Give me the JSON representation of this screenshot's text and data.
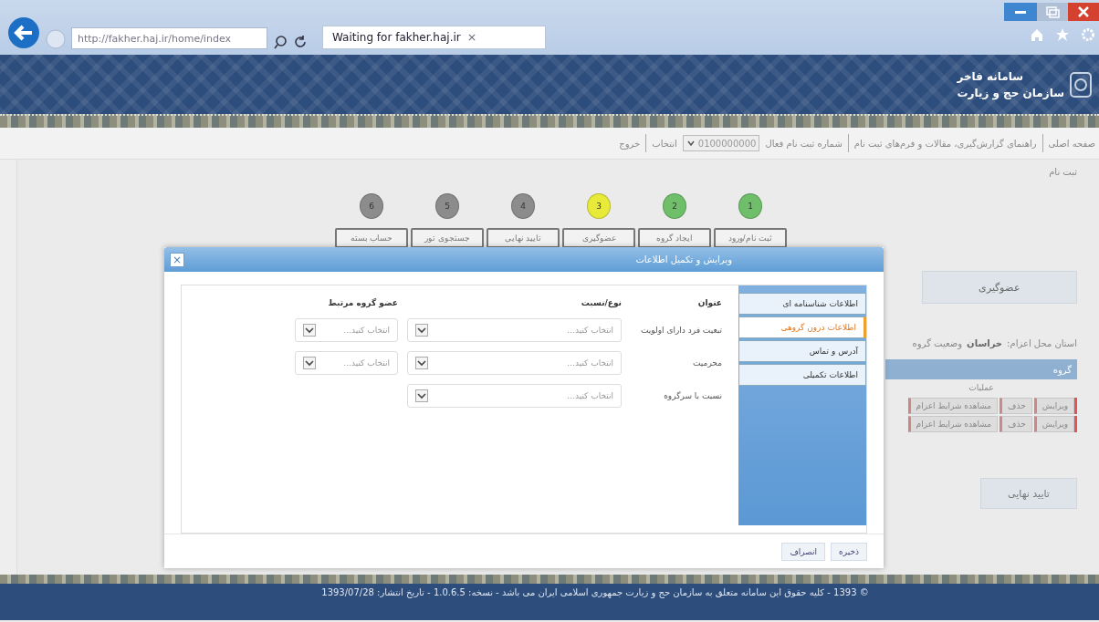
{
  "browser": {
    "url": "http://fakher.haj.ir/home/index",
    "tab_title": "Waiting for fakher.haj.ir"
  },
  "header": {
    "title": "سامانه فاخر",
    "subtitle": "سازمان حج و زیارت"
  },
  "nav": {
    "items": [
      "صفحه اصلی",
      "راهنمای گزارش‌گیری، مقالات و فرم‌های ثبت نام"
    ],
    "registration_label": "شماره ثبت نام فعال",
    "registration_value": "0100000000",
    "choose": "انتخاب",
    "logout": "خروج"
  },
  "page_title": "ثبت نام",
  "steps": [
    {
      "number": "1",
      "label": "ثبت نام/ورود",
      "color": "#6fbf6a"
    },
    {
      "number": "2",
      "label": "ایجاد گروه",
      "color": "#6fbf6a"
    },
    {
      "number": "3",
      "label": "عضوگیری",
      "color": "#e8ea3a"
    },
    {
      "number": "4",
      "label": "تایید نهایی",
      "color": "#8c8c8c"
    },
    {
      "number": "5",
      "label": "جستجوی تور",
      "color": "#8c8c8c"
    },
    {
      "number": "6",
      "label": "حساب بسته",
      "color": "#8c8c8c"
    }
  ],
  "panel": {
    "tab": "عضوگیری",
    "province_label": "استان محل اعزام:",
    "province": "خراسان",
    "group_status_label": "وضعیت گروه",
    "table_title": "گروه",
    "column": "عملیات",
    "rows": [
      [
        "ویرایش",
        "حذف",
        "مشاهده شرایط اعزام"
      ],
      [
        "ویرایش",
        "حذف",
        "مشاهده شرایط اعزام"
      ]
    ],
    "confirm_button": "تایید نهایی"
  },
  "modal": {
    "title": "ویرایش و تکمیل اطلاعات",
    "close": "×",
    "tabs": [
      {
        "label": "اطلاعات شناسنامه ای",
        "selected": false
      },
      {
        "label": "اطلاعات درون گروهی",
        "selected": true
      },
      {
        "label": "آدرس و تماس",
        "selected": false
      },
      {
        "label": "اطلاعات تکمیلی",
        "selected": false
      }
    ],
    "columns": [
      "عنوان",
      "نوع/نسبت",
      "عضو گروه مرتبط"
    ],
    "rows": [
      {
        "label": "تبعیت فرد دارای اولویت",
        "relation": {
          "placeholder": "انتخاب کنید..."
        },
        "member": {
          "placeholder": "انتخاب کنید..."
        }
      },
      {
        "label": "محرمیت",
        "relation": {
          "placeholder": "انتخاب کنید..."
        },
        "member": {
          "placeholder": "انتخاب کنید..."
        }
      },
      {
        "label": "نسبت با سرگروه",
        "relation": {
          "placeholder": "انتخاب کنید..."
        }
      }
    ],
    "buttons": [
      "ذخیره",
      "انصراف"
    ]
  },
  "footer": "© 1393 - کلیه حقوق این سامانه متعلق به سازمان حج و زیارت جمهوری اسلامی ایران می باشد - نسخه: 1.0.6.5 - تاریخ انتشار: 1393/07/28"
}
